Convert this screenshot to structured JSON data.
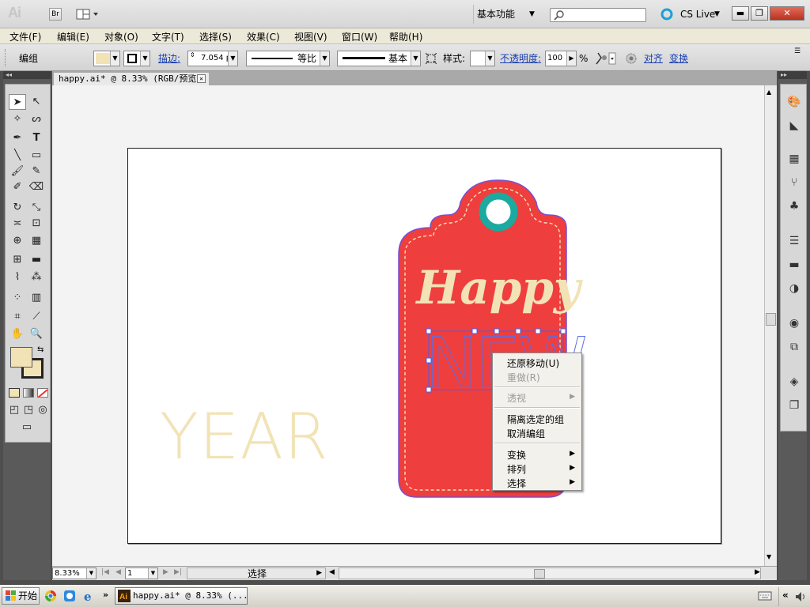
{
  "app": {
    "logo": "Ai",
    "bridge_label": "Br",
    "workspace": "基本功能",
    "search_placeholder": "",
    "cs_live": "CS Live"
  },
  "window_buttons": [
    "▬",
    "❐",
    "✕"
  ],
  "menubar": [
    "文件(F)",
    "编辑(E)",
    "对象(O)",
    "文字(T)",
    "选择(S)",
    "效果(C)",
    "视图(V)",
    "窗口(W)",
    "帮助(H)"
  ],
  "controlbar": {
    "selection_type": "编组",
    "stroke_label": "描边:",
    "stroke_weight": "7.054 p",
    "stroke_profile": "等比",
    "brush": "基本",
    "style_label": "样式:",
    "opacity_label": "不透明度:",
    "opacity_value": "100",
    "opacity_unit": "%",
    "align_label": "对齐",
    "transform_label": "变换"
  },
  "document": {
    "tab_title": "happy.ai* @ 8.33% (RGB/预览)"
  },
  "artwork": {
    "tag_color": "#ef3e3e",
    "ring_color": "#1aaaa0",
    "text_color": "#f2e3b6",
    "happy_text": "Happy",
    "new_text": "NEW",
    "year_text": "YEAR"
  },
  "context_menu": {
    "items": [
      {
        "label": "还原移动(U)",
        "enabled": true,
        "submenu": false
      },
      {
        "label": "重做(R)",
        "enabled": false,
        "submenu": false
      },
      {
        "label": "透视",
        "enabled": false,
        "submenu": true
      },
      {
        "label": "隔离选定的组",
        "enabled": true,
        "submenu": false
      },
      {
        "label": "取消编组",
        "enabled": true,
        "submenu": false
      },
      {
        "label": "变换",
        "enabled": true,
        "submenu": true
      },
      {
        "label": "排列",
        "enabled": true,
        "submenu": true
      },
      {
        "label": "选择",
        "enabled": true,
        "submenu": true
      }
    ]
  },
  "statusbar": {
    "zoom": "8.33%",
    "page": "1",
    "status_text": "选择"
  },
  "taskbar": {
    "start_label": "开始",
    "task_item": "happy.ai* @ 8.33% (..."
  }
}
